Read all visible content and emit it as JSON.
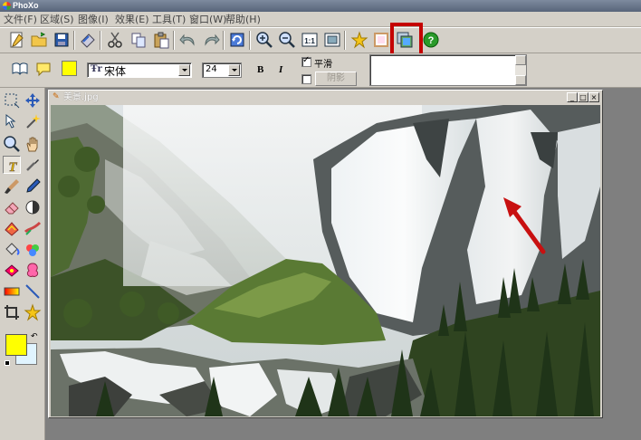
{
  "app": {
    "title": "PhoXo"
  },
  "menu": [
    {
      "label": "文件(F)"
    },
    {
      "label": "区域(S)"
    },
    {
      "label": "图像(I)"
    },
    {
      "label": "效果(E)"
    },
    {
      "label": "工具(T)"
    },
    {
      "label": "窗口(W)"
    },
    {
      "label": "帮助(H)"
    }
  ],
  "text_toolbar": {
    "font_name": "宋体",
    "font_prefix": "Ŧr",
    "font_size": "24",
    "bold_label": "B",
    "italic_label": "I",
    "smooth_label": "平滑",
    "smooth_checked": true,
    "shadow_label": "阴影",
    "text_color": "#ffff00"
  },
  "document": {
    "title": "美景.jpg"
  },
  "colors": {
    "foreground": "#ffff00",
    "background": "#e0f4ff",
    "highlight": "#c40000"
  }
}
